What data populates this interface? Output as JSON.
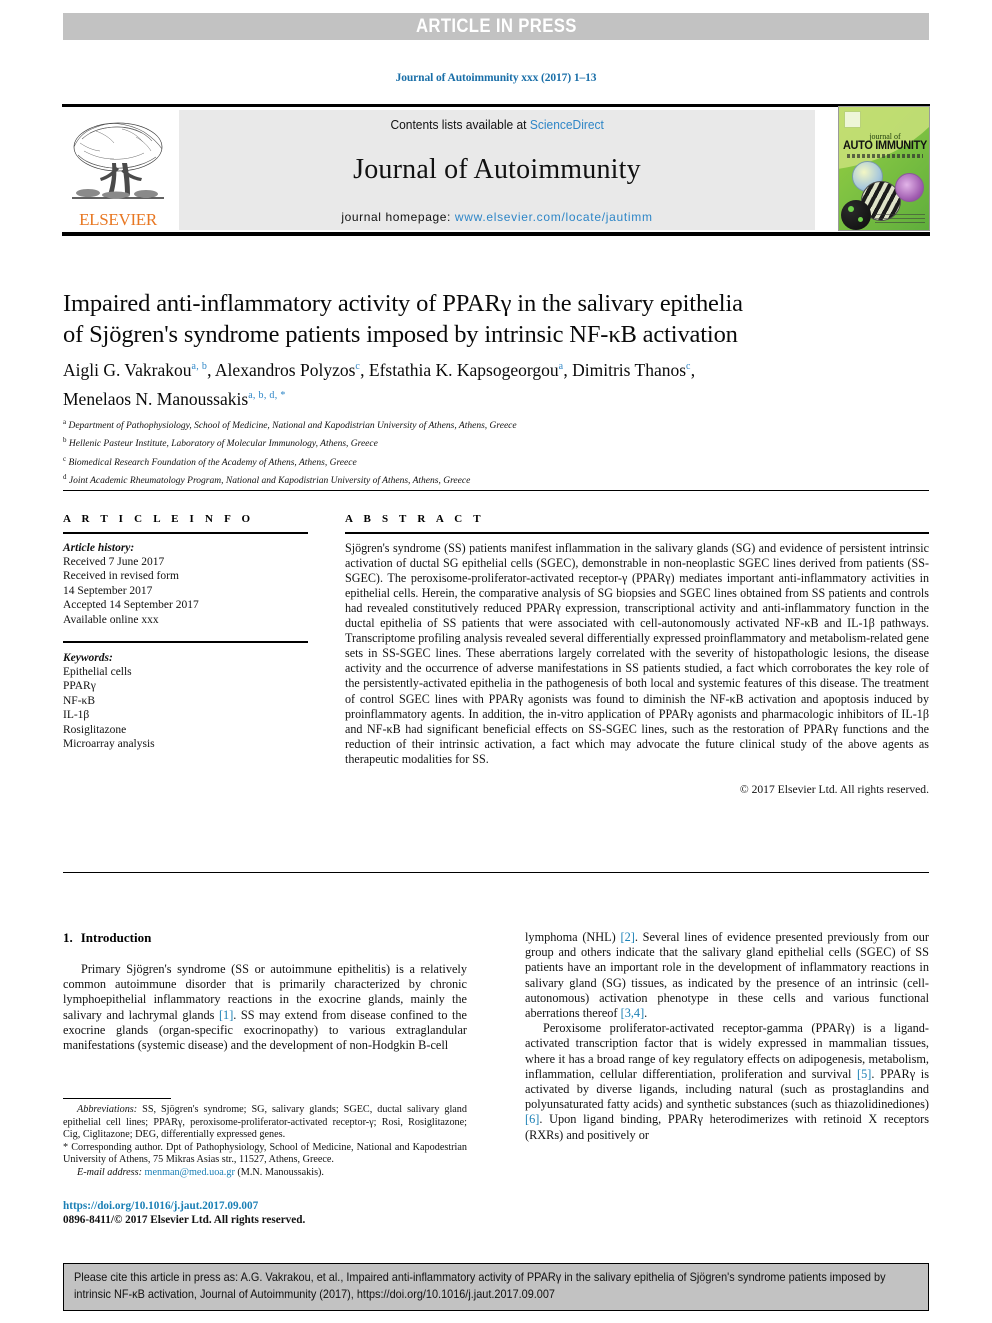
{
  "banner": {
    "text": "ARTICLE IN PRESS"
  },
  "running_head": {
    "text": "Journal of Autoimmunity xxx (2017) 1–13"
  },
  "masthead": {
    "contents_prefix": "Contents lists available at ",
    "sciencedirect": "ScienceDirect",
    "journal_name": "Journal of Autoimmunity",
    "homepage_prefix": "journal homepage: ",
    "homepage_url": "www.elsevier.com/locate/jautimm",
    "publisher": "ELSEVIER",
    "cover": {
      "journal_of": "journal of",
      "title": "AUTO IMMUNITY"
    }
  },
  "article": {
    "title_line1": "Impaired anti-inflammatory activity of PPARγ in the salivary epithelia",
    "title_line2": "of Sjögren's syndrome patients imposed by intrinsic NF-κB activation",
    "authors": [
      {
        "name": "Aigli G. Vakrakou",
        "marks": "a, b"
      },
      {
        "name": "Alexandros Polyzos",
        "marks": "c"
      },
      {
        "name": "Efstathia K. Kapsogeorgou",
        "marks": "a"
      },
      {
        "name": "Dimitris Thanos",
        "marks": "c"
      },
      {
        "name": "Menelaos N. Manoussakis",
        "marks": "a, b, d, *"
      }
    ],
    "affiliations": [
      {
        "mark": "a",
        "text": "Department of Pathophysiology, School of Medicine, National and Kapodistrian University of Athens, Athens, Greece"
      },
      {
        "mark": "b",
        "text": "Hellenic Pasteur Institute, Laboratory of Molecular Immunology, Athens, Greece"
      },
      {
        "mark": "c",
        "text": "Biomedical Research Foundation of the Academy of Athens, Athens, Greece"
      },
      {
        "mark": "d",
        "text": "Joint Academic Rheumatology Program, National and Kapodistrian University of Athens, Athens, Greece"
      }
    ]
  },
  "article_info": {
    "heading": "A R T I C L E  I N F O",
    "history_label": "Article history:",
    "history": [
      "Received 7 June 2017",
      "Received in revised form",
      "14 September 2017",
      "Accepted 14 September 2017",
      "Available online xxx"
    ],
    "keywords_label": "Keywords:",
    "keywords": [
      "Epithelial cells",
      "PPARγ",
      "NF-κB",
      "IL-1β",
      "Rosiglitazone",
      "Microarray analysis"
    ]
  },
  "abstract": {
    "heading": "A B S T R A C T",
    "body": "Sjögren's syndrome (SS) patients manifest inflammation in the salivary glands (SG) and evidence of persistent intrinsic activation of ductal SG epithelial cells (SGEC), demonstrable in non-neoplastic SGEC lines derived from patients (SS-SGEC). The peroxisome-proliferator-activated receptor-γ (PPARγ) mediates important anti-inflammatory activities in epithelial cells. Herein, the comparative analysis of SG biopsies and SGEC lines obtained from SS patients and controls had revealed constitutively reduced PPARγ expression, transcriptional activity and anti-inflammatory function in the ductal epithelia of SS patients that were associated with cell-autonomously activated NF-κB and IL-1β pathways. Transcriptome profiling analysis revealed several differentially expressed proinflammatory and metabolism-related gene sets in SS-SGEC lines. These aberrations largely correlated with the severity of histopathologic lesions, the disease activity and the occurrence of adverse manifestations in SS patients studied, a fact which corroborates the key role of the persistently-activated epithelia in the pathogenesis of both local and systemic features of this disease. The treatment of control SGEC lines with PPARγ agonists was found to diminish the NF-κB activation and apoptosis induced by proinflammatory agents. In addition, the in-vitro application of PPARγ agonists and pharmacologic inhibitors of IL-1β and NF-κB had significant beneficial effects on SS-SGEC lines, such as the restoration of PPARγ functions and the reduction of their intrinsic activation, a fact which may advocate the future clinical study of the above agents as therapeutic modalities for SS.",
    "copyright": "© 2017 Elsevier Ltd. All rights reserved."
  },
  "introduction": {
    "number": "1.",
    "heading": "Introduction",
    "para_left_1_a": "Primary Sjögren's syndrome (SS or autoimmune epithelitis) is a relatively common autoimmune disorder that is primarily characterized by chronic lymphoepithelial inflammatory reactions in the exocrine glands, mainly the salivary and lachrymal glands ",
    "ref1": "[1]",
    "para_left_1_b": ". SS may extend from disease confined to the exocrine glands (organ-specific exocrinopathy) to various extraglandular manifestations (systemic disease) and the development of non-Hodgkin B-cell",
    "para_right_1_a": "lymphoma (NHL) ",
    "ref2": "[2]",
    "para_right_1_b": ". Several lines of evidence presented previously from our group and others indicate that the salivary gland epithelial cells (SGEC) of SS patients have an important role in the development of inflammatory reactions in salivary gland (SG) tissues, as indicated by the presence of an intrinsic (cell-autonomous) activation phenotype in these cells and various functional aberrations thereof ",
    "ref34": "[3,4]",
    "para_right_1_c": ".",
    "para_right_2_a": "Peroxisome proliferator-activated receptor-gamma (PPARγ) is a ligand-activated transcription factor that is widely expressed in mammalian tissues, where it has a broad range of key regulatory effects on adipogenesis, metabolism, inflammation, cellular differentiation, proliferation and survival ",
    "ref5": "[5]",
    "para_right_2_b": ". PPARγ is activated by diverse ligands, including natural (such as prostaglandins and polyunsaturated fatty acids) and synthetic substances (such as thiazolidinediones) ",
    "ref6": "[6]",
    "para_right_2_c": ". Upon ligand binding, PPARγ heterodimerizes with retinoid X receptors (RXRs) and positively or"
  },
  "footnotes": {
    "abbrev_label": "Abbreviations:",
    "abbrev_text": " SS, Sjögren's syndrome; SG, salivary glands; SGEC, ductal salivary gland epithelial cell lines; PPARγ, peroxisome-proliferator-activated receptor-γ; Rosi, Rosiglitazone; Cig, Ciglitazone; DEG, differentially expressed genes.",
    "corresponding": "* Corresponding author. Dpt of Pathophysiology, School of Medicine, National and Kapodestrian University of Athens, 75 Mikras Asias str., 11527, Athens, Greece.",
    "email_label": "E-mail address:",
    "email": "menman@med.uoa.gr",
    "email_suffix": " (M.N. Manoussakis).",
    "doi": "https://doi.org/10.1016/j.jaut.2017.09.007",
    "issn": "0896-8411/© 2017 Elsevier Ltd. All rights reserved."
  },
  "cite_box": {
    "text": "Please cite this article in press as: A.G. Vakrakou, et al., Impaired anti-inflammatory activity of PPARγ in the salivary epithelia of Sjögren's syndrome patients imposed by intrinsic NF-κB activation, Journal of Autoimmunity (2017), https://doi.org/10.1016/j.jaut.2017.09.007"
  },
  "colors": {
    "banner_bg": "#c2c2c2",
    "link_blue": "#2e86c7",
    "ref_blue": "#1a7fb5",
    "elsevier_orange": "#e87722",
    "masthead_gray": "#e9e9e9"
  }
}
